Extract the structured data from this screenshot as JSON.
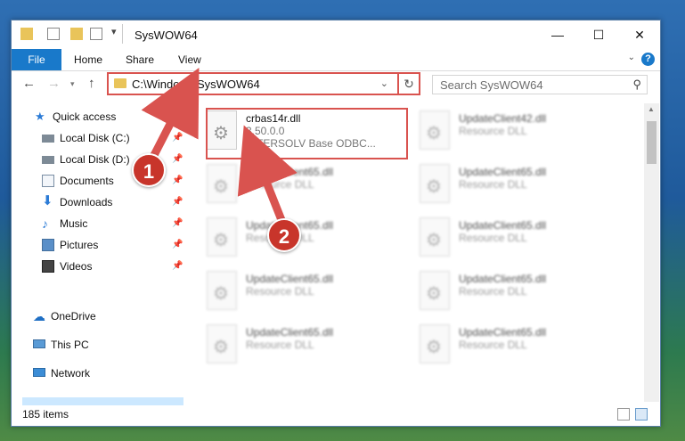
{
  "window": {
    "title": "SysWOW64",
    "controls": {
      "minimize": "—",
      "maximize": "☐",
      "close": "✕"
    }
  },
  "ribbon": {
    "file": "File",
    "tabs": [
      "Home",
      "Share",
      "View"
    ],
    "help": "?"
  },
  "address": {
    "path": "C:\\Windows\\SysWOW64",
    "search_placeholder": "Search SysWOW64"
  },
  "nav": {
    "quick_access": "Quick access",
    "items": [
      {
        "label": "Local Disk (C:)",
        "icon": "drive-icon"
      },
      {
        "label": "Local Disk (D:)",
        "icon": "drive-icon"
      },
      {
        "label": "Documents",
        "icon": "documents-icon"
      },
      {
        "label": "Downloads",
        "icon": "downloads-icon"
      },
      {
        "label": "Music",
        "icon": "music-icon"
      },
      {
        "label": "Pictures",
        "icon": "pictures-icon"
      },
      {
        "label": "Videos",
        "icon": "videos-icon"
      }
    ],
    "onedrive": "OneDrive",
    "this_pc": "This PC",
    "network": "Network"
  },
  "files": {
    "highlighted": {
      "name": "crbas14r.dll",
      "version": "3.50.0.0",
      "description": "INTERSOLV Base ODBC..."
    },
    "others": [
      {
        "name": "UpdateClient42.dll",
        "type": "Resource DLL"
      },
      {
        "name": "UpdateClient65.dll",
        "type": "Resource DLL"
      },
      {
        "name": "UpdateClient65.dll",
        "type": "Resource DLL"
      },
      {
        "name": "UpdateClient65.dll",
        "type": "Resource DLL"
      },
      {
        "name": "UpdateClient65.dll",
        "type": "Resource DLL"
      },
      {
        "name": "UpdateClient65.dll",
        "type": "Resource DLL"
      },
      {
        "name": "UpdateClient65.dll",
        "type": "Resource DLL"
      },
      {
        "name": "UpdateClient65.dll",
        "type": "Resource DLL"
      },
      {
        "name": "UpdateClient65.dll",
        "type": "Resource DLL"
      }
    ]
  },
  "status": {
    "count": "185 items"
  },
  "callouts": [
    "1",
    "2"
  ],
  "colors": {
    "accent": "#1979ca",
    "highlight": "#d9534f",
    "callout": "#c8352b",
    "selected": "#cce8ff"
  }
}
